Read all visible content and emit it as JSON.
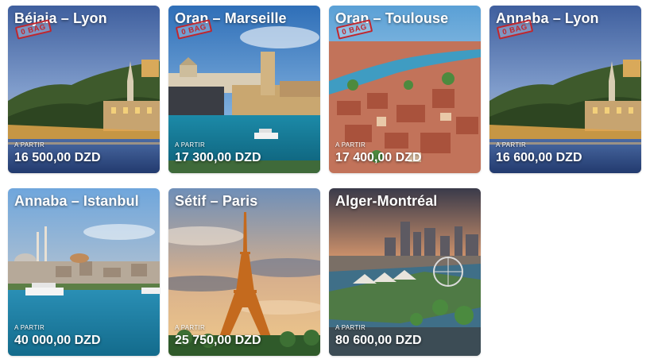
{
  "destinations": [
    {
      "title": "Béjaia – Lyon",
      "stamp": "0 BAG",
      "from_label": "A PARTIR",
      "price": "16 500,00 DZD"
    },
    {
      "title": "Oran – Marseille",
      "stamp": "0 BAG",
      "from_label": "A PARTIR",
      "price": "17 300,00 DZD"
    },
    {
      "title": "Oran – Toulouse",
      "stamp": "0 BAG",
      "from_label": "A PARTIR",
      "price": "17 400,00 DZD"
    },
    {
      "title": "Annaba – Lyon",
      "stamp": "0 BAG",
      "from_label": "A PARTIR",
      "price": "16 600,00 DZD"
    },
    {
      "title": "Annaba – Istanbul",
      "from_label": "A PARTIR",
      "price": "40 000,00 DZD"
    },
    {
      "title": "Sétif – Paris",
      "from_label": "A PARTIR",
      "price": "25 750,00 DZD"
    },
    {
      "title": "Alger-Montréal",
      "from_label": "A PARTIR",
      "price": "80 600,00 DZD"
    }
  ],
  "colors": {
    "stamp_red": "#c0262d",
    "text": "#ffffff"
  }
}
